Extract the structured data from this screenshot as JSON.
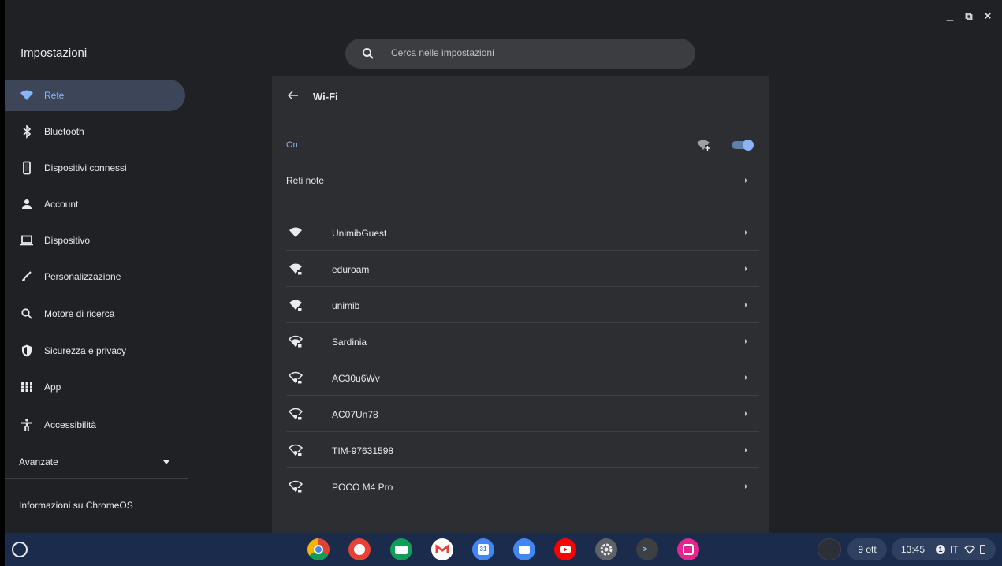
{
  "window": {
    "minimize": "_",
    "restore": "⧉",
    "close": "×"
  },
  "app": {
    "title": "Impostazioni"
  },
  "search": {
    "placeholder": "Cerca nelle impostazioni"
  },
  "sidebar": {
    "items": [
      {
        "label": "Rete",
        "icon": "wifi-icon",
        "active": true
      },
      {
        "label": "Bluetooth",
        "icon": "bluetooth-icon"
      },
      {
        "label": "Dispositivi connessi",
        "icon": "phone-icon"
      },
      {
        "label": "Account",
        "icon": "person-icon"
      },
      {
        "label": "Dispositivo",
        "icon": "laptop-icon"
      },
      {
        "label": "Personalizzazione",
        "icon": "brush-icon"
      },
      {
        "label": "Motore di ricerca",
        "icon": "search-icon"
      },
      {
        "label": "Sicurezza e privacy",
        "icon": "shield-icon"
      },
      {
        "label": "App",
        "icon": "apps-grid-icon"
      },
      {
        "label": "Accessibilità",
        "icon": "accessibility-icon"
      }
    ],
    "advanced": "Avanzate",
    "about": "Informazioni su ChromeOS"
  },
  "main": {
    "title": "Wi-Fi",
    "wifi_state": "On",
    "wifi_enabled": true,
    "known_networks": "Reti note",
    "networks": [
      {
        "name": "UnimibGuest",
        "secured": false,
        "signal": "full"
      },
      {
        "name": "eduroam",
        "secured": true,
        "signal": "full"
      },
      {
        "name": "unimib",
        "secured": true,
        "signal": "full"
      },
      {
        "name": "Sardinia",
        "secured": true,
        "signal": "medium"
      },
      {
        "name": "AC30u6Wv",
        "secured": true,
        "signal": "weak"
      },
      {
        "name": "AC07Un78",
        "secured": true,
        "signal": "weak"
      },
      {
        "name": "TIM-97631598",
        "secured": true,
        "signal": "weak"
      },
      {
        "name": "POCO M4 Pro",
        "secured": true,
        "signal": "weak"
      }
    ]
  },
  "shelf": {
    "apps": [
      "chrome-icon",
      "palette-icon",
      "classroom-icon",
      "gmail-icon",
      "calendar-icon",
      "files-icon",
      "youtube-icon",
      "settings-icon",
      "terminal-icon",
      "photos-icon"
    ],
    "calendar_day": "31",
    "terminal_glyph": ">_",
    "date": "9 ott",
    "time": "13:45",
    "notifications": "1",
    "ime": "IT"
  },
  "colors": {
    "accent": "#8ab4f8",
    "background": "#202124",
    "card": "#2d2e31",
    "shelf": "#1b2b4b"
  }
}
